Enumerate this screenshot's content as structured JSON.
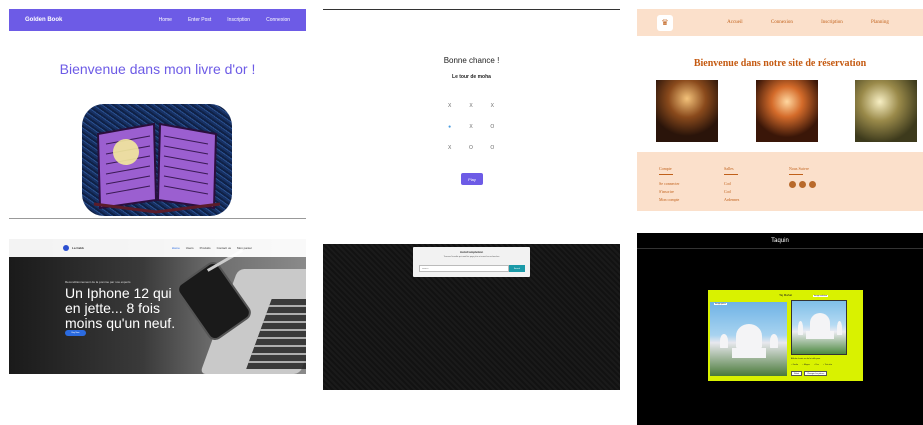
{
  "golden_book": {
    "brand": "Golden Book",
    "nav": [
      "Home",
      "Enter Post",
      "Inscription",
      "Connexion"
    ],
    "welcome": "Bienvenue dans mon livre d'or !"
  },
  "tictactoe": {
    "title": "Bonne chance !",
    "turn": "Le tour de moha",
    "cells": [
      "X",
      "X",
      "X",
      "●",
      "X",
      "O",
      "X",
      "O",
      "O"
    ],
    "button": "Play"
  },
  "reservation": {
    "logo": "♛",
    "nav": [
      "Accueil",
      "Connexion",
      "Inscription",
      "Planning"
    ],
    "title": "Bienvenue dans notre site de réservation",
    "footer": {
      "col1": {
        "title": "Compte",
        "items": [
          "Se connecter",
          "S'inscrire",
          "Mon compte"
        ]
      },
      "col2": {
        "title": "Salles",
        "items": [
          "Cod",
          "Cod",
          "Ardennes"
        ]
      },
      "col3": {
        "title": "Nous Suivre"
      }
    }
  },
  "iphone": {
    "brand": "La Cabb",
    "nav": [
      "Home",
      "Users",
      "Produits",
      "Contact us",
      "Mon panier"
    ],
    "eyebrow": "Reconditionnement de la pomme par nos experts",
    "headline": "Un Iphone 12 qui en jette... 8 fois moins qu'un neuf.",
    "cta": "Buy Now"
  },
  "autocomplete": {
    "title": "AutoCompletion",
    "description": "Trouvez l'insolite qui rend les pays plus et aussi les recherches",
    "placeholder": "Search",
    "button": "Search"
  },
  "taj": {
    "header": "Taquin",
    "panel_title": "Taj Mahal",
    "label1": "Image pièce",
    "label2": "Image solution",
    "caption": "Affiche choisir un de la taille pour",
    "radios": [
      "Facile",
      "Moyen",
      "Dur",
      "Très dur"
    ],
    "buttons": [
      "Réinit",
      "Changer les pièces"
    ]
  },
  "colors": {
    "purple": "#6d5be6",
    "peach": "#fbe0cb",
    "orange": "#c55a11",
    "lime": "#d9f200",
    "teal": "#1b9aa8",
    "blue": "#2b6be0"
  }
}
